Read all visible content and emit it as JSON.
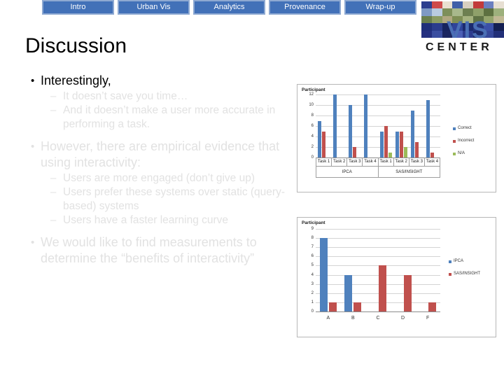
{
  "navbar": {
    "tabs": [
      {
        "label": "Intro",
        "name": "tab-intro"
      },
      {
        "label": "Urban Vis",
        "name": "tab-urban-vis"
      },
      {
        "label": "Analytics",
        "name": "tab-analytics"
      },
      {
        "label": "Provenance",
        "name": "tab-provenance"
      },
      {
        "label": "Wrap-up",
        "name": "tab-wrap-up"
      }
    ],
    "tab_fill": "#4271B8",
    "tab_border": "#8EA9D2",
    "tab_text_color": "#FFFFFF"
  },
  "logo": {
    "word_vis": "VIS",
    "word_center": "CENTER",
    "vis_color": "#4A6FB5",
    "center_color": "#1A1A1A"
  },
  "slide": {
    "title": "Discussion",
    "title_color": "#000000",
    "faded_text_color": "#E2E2E2"
  },
  "content": {
    "blocks": [
      {
        "level": 1,
        "marker": "•",
        "text": "Interestingly,",
        "state": "dark"
      },
      {
        "level": 2,
        "marker": "–",
        "text": "It doesn’t save you time…",
        "state": "faded"
      },
      {
        "level": 2,
        "marker": "–",
        "text": "And it doesn’t make a user more accurate in performing a task.",
        "state": "faded"
      },
      {
        "level": 1,
        "marker": "•",
        "text": "However, there are empirical evidence that using interactivity:",
        "state": "faded"
      },
      {
        "level": 2,
        "marker": "–",
        "text": "Users are more engaged (don’t give up)",
        "state": "faded"
      },
      {
        "level": 2,
        "marker": "–",
        "text": "Users prefer these systems over static (query-based) systems",
        "state": "faded"
      },
      {
        "level": 2,
        "marker": "–",
        "text": "Users have a faster learning curve",
        "state": "faded"
      },
      {
        "level": 1,
        "marker": "•",
        "text": "We would like to find measurements to determine the “benefits of interactivity”",
        "state": "faded"
      }
    ]
  },
  "chart_data": [
    {
      "id": "chart-top",
      "type": "bar",
      "title": "",
      "ylabel": "Participant",
      "xlabel": "",
      "ylim": [
        0,
        12
      ],
      "yticks": [
        0,
        2,
        4,
        6,
        8,
        10,
        12
      ],
      "grid": true,
      "legend_position": "right",
      "categories": [
        "Task 1",
        "Task 2",
        "Task 3",
        "Task 4",
        "Task 1",
        "Task 2",
        "Task 3",
        "Task 4"
      ],
      "groups": [
        {
          "label": "IPCA",
          "span": 4
        },
        {
          "label": "SAS/INSIGHT",
          "span": 4
        }
      ],
      "series": [
        {
          "name": "Correct",
          "color": "#4F81BD",
          "values": [
            7,
            12,
            10,
            12,
            5,
            5,
            9,
            11
          ]
        },
        {
          "name": "Incorrect",
          "color": "#C0504D",
          "values": [
            5,
            0,
            2,
            0,
            6,
            5,
            3,
            1
          ]
        },
        {
          "name": "N/A",
          "color": "#9BBB59",
          "values": [
            0,
            0,
            0,
            0,
            1,
            2,
            0,
            0
          ]
        }
      ]
    },
    {
      "id": "chart-bottom",
      "type": "bar",
      "title": "",
      "ylabel": "Participant",
      "xlabel": "",
      "ylim": [
        0,
        9
      ],
      "yticks": [
        0,
        1,
        2,
        3,
        4,
        5,
        6,
        7,
        8,
        9
      ],
      "grid": true,
      "legend_position": "right",
      "categories": [
        "A",
        "B",
        "C",
        "D",
        "F"
      ],
      "series": [
        {
          "name": "IPCA",
          "color": "#4F81BD",
          "values": [
            8,
            4,
            0,
            0,
            0
          ]
        },
        {
          "name": "SAS/INSIGHT",
          "color": "#C0504D",
          "values": [
            1,
            1,
            5,
            4,
            1
          ]
        }
      ]
    }
  ]
}
